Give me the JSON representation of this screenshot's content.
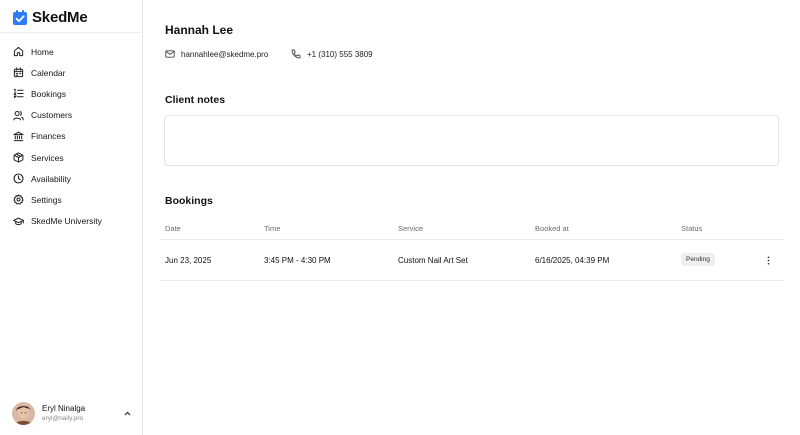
{
  "app": {
    "name": "SkedMe",
    "accent_color": "#2f7cf6",
    "icon": "calendar-check-icon"
  },
  "sidebar": {
    "items": [
      {
        "label": "Home",
        "icon": "home-icon"
      },
      {
        "label": "Calendar",
        "icon": "calendar-icon"
      },
      {
        "label": "Bookings",
        "icon": "list-ordered-icon"
      },
      {
        "label": "Customers",
        "icon": "users-icon"
      },
      {
        "label": "Finances",
        "icon": "bank-icon"
      },
      {
        "label": "Services",
        "icon": "box-icon"
      },
      {
        "label": "Availability",
        "icon": "clock-icon"
      },
      {
        "label": "Settings",
        "icon": "gear-icon"
      },
      {
        "label": "SkedMe University",
        "icon": "graduation-cap-icon"
      }
    ],
    "user": {
      "name": "Eryl Ninalga",
      "email": "eryl@naily.pro",
      "avatar_icon": "user-avatar",
      "toggle_icon": "chevron-up-icon"
    }
  },
  "client": {
    "name": "Hannah Lee",
    "email": "hannahlee@skedme.pro",
    "phone": "+1 (310) 555 3809",
    "email_icon": "mail-icon",
    "phone_icon": "phone-icon"
  },
  "notes": {
    "title": "Client notes",
    "value": ""
  },
  "bookings": {
    "title": "Bookings",
    "columns": [
      "Date",
      "Time",
      "Service",
      "Booked at",
      "Status"
    ],
    "rows": [
      {
        "date": "Jun 23, 2025",
        "time": "3:45 PM - 4:30 PM",
        "service": "Custom Nail Art Set",
        "booked_at": "6/16/2025, 04:39 PM",
        "status": "Pending",
        "menu_icon": "more-vertical-icon"
      }
    ]
  }
}
